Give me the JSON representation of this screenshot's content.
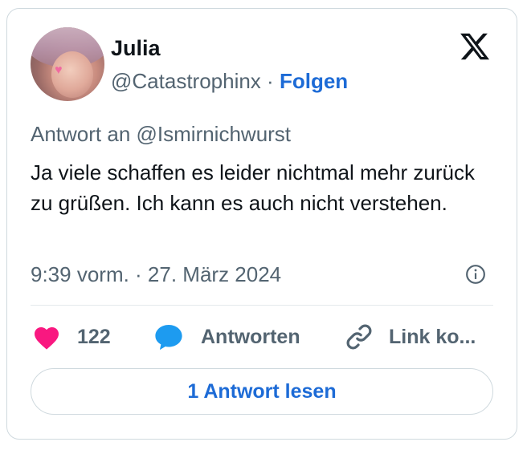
{
  "author": {
    "name": "Julia",
    "handle": "@Catastrophinx",
    "separator": "·",
    "follow_label": "Folgen"
  },
  "tweet": {
    "reply_to": "Antwort an @Ismirnichwurst",
    "text": "Ja viele schaffen es leider nichtmal mehr zurück zu grüßen. Ich kann es auch nicht verstehen.",
    "timestamp": "9:39 vorm. · 27. März 2024"
  },
  "actions": {
    "like_count": "122",
    "reply_label": "Antworten",
    "copy_link_label": "Link ko..."
  },
  "read_replies_label": "1 Antwort lesen",
  "colors": {
    "like": "#f91880",
    "reply_bubble": "#1d9bf0",
    "link_blue": "#1d6bd6",
    "muted": "#536471"
  },
  "icons": [
    "x-logo-icon",
    "info-icon",
    "heart-icon",
    "speech-bubble-icon",
    "link-icon"
  ]
}
